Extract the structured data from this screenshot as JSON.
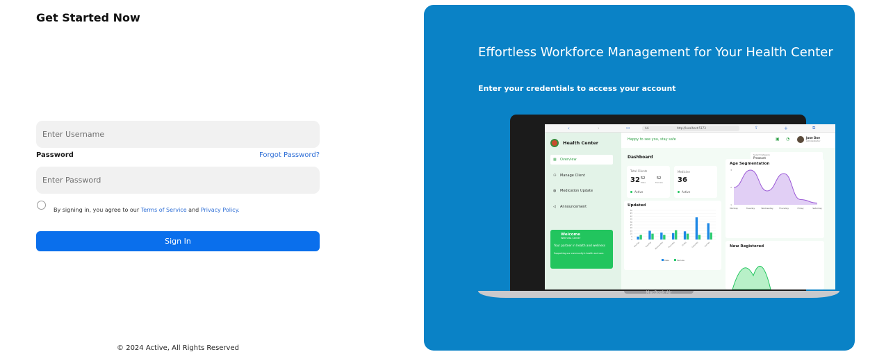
{
  "form": {
    "title": "Get Started Now",
    "username_placeholder": "Enter Username",
    "password_label": "Password",
    "forgot_password": "Forgot Password?",
    "password_placeholder": "Enter Password",
    "terms_prefix": "By signing in, you agree to our",
    "terms_link": "Terms of Service",
    "terms_and": "and",
    "privacy_link": "Privacy Policy.",
    "signin_button": "Sign In",
    "footer": "© 2024 Active, All Rights Reserved"
  },
  "panel": {
    "title": "Effortless Workforce Management for Your Health Center",
    "subtitle": "Enter your credentials to access your account",
    "background_color": "#0a82c6"
  },
  "mockup": {
    "laptop_brand": "MacBook Air",
    "url": "http://localhost:5173",
    "url_prefix": "AA",
    "app_name": "Health Center",
    "greeting": "Happy to see you, stay safe",
    "user_name": "Jane Doe",
    "user_role": "Administrator",
    "dashboard_title": "Dashboard",
    "select_label": "Select Category",
    "select_value": "Pregnant",
    "nav": [
      {
        "label": "Overview",
        "icon": "grid-icon",
        "active": true
      },
      {
        "label": "Manage Client",
        "icon": "users-icon",
        "active": false
      },
      {
        "label": "Medication Update",
        "icon": "pill-icon",
        "active": false
      },
      {
        "label": "Announcement",
        "icon": "megaphone-icon",
        "active": false
      }
    ],
    "welcome": {
      "title": "Welcome",
      "subtitle": "Wellness Center",
      "tagline": "Your partner in health and wellness",
      "note": "Supporting our community's health and care."
    },
    "total_clients": {
      "label": "Total Clients",
      "value": "32",
      "sup": "52",
      "sub": "Male",
      "female_value": "52",
      "female_label": "Female",
      "status": "Active"
    },
    "medicine": {
      "label": "Medicine",
      "value": "36",
      "status": "Active"
    },
    "updated_title": "Updated",
    "age_title": "Age Segmentation",
    "new_registered_title": "New Registered"
  },
  "chart_data": [
    {
      "type": "bar",
      "title": "Updated",
      "categories": [
        "Monday",
        "Tuesday",
        "Wednesday",
        "Thursday",
        "Friday",
        "Saturday",
        "Sunday"
      ],
      "ylim": [
        0,
        50
      ],
      "yticks": [
        0,
        5,
        10,
        15,
        20,
        25,
        30,
        35,
        40,
        45,
        50
      ],
      "series": [
        {
          "name": "Male",
          "color": "#1e88e5",
          "values": [
            5,
            15,
            12,
            11,
            14,
            38,
            28
          ]
        },
        {
          "name": "Female",
          "color": "#2ecc71",
          "values": [
            8,
            10,
            8,
            16,
            10,
            8,
            12
          ]
        }
      ]
    },
    {
      "type": "area",
      "title": "Age Segmentation",
      "categories": [
        "Monday",
        "Tuesday",
        "Wednesday",
        "Thursday",
        "Friday",
        "Saturday"
      ],
      "ylim": [
        1,
        3
      ],
      "yticks": [
        1,
        2,
        3
      ],
      "series": [
        {
          "color": "#9b59d6",
          "values": [
            2,
            3,
            1.8,
            2.8,
            1.3,
            1.1
          ]
        }
      ]
    }
  ]
}
